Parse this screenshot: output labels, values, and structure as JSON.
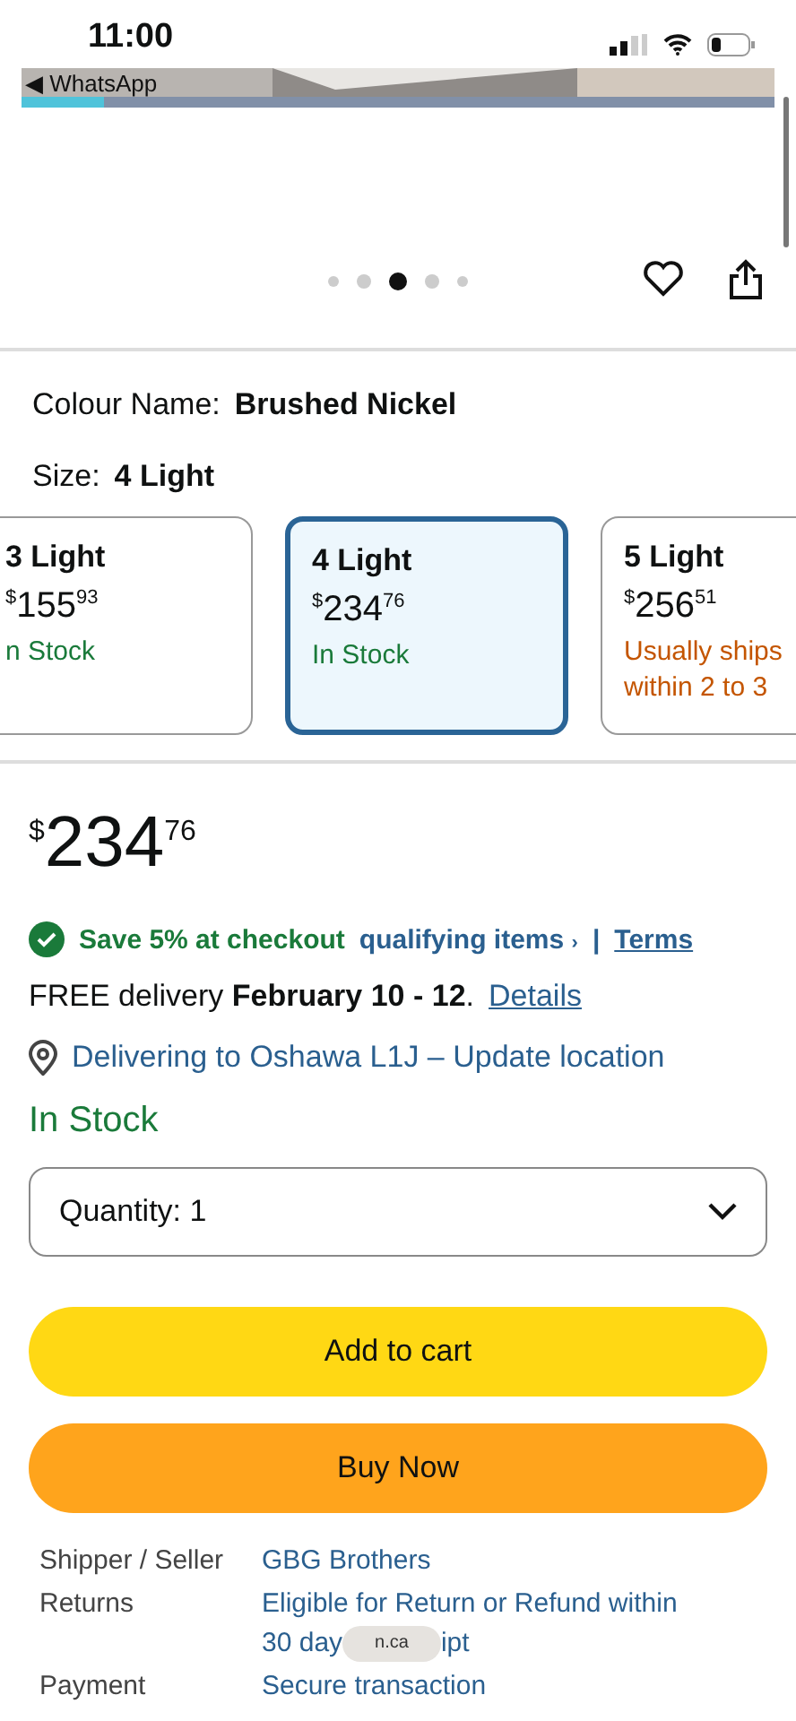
{
  "status_bar": {
    "time": "11:00",
    "back_label": "◀ WhatsApp"
  },
  "gallery": {
    "dots": [
      {
        "selected": false
      },
      {
        "selected": false
      },
      {
        "selected": true
      },
      {
        "selected": false
      },
      {
        "selected": false
      }
    ]
  },
  "colour": {
    "label": "Colour Name:",
    "value": "Brushed Nickel"
  },
  "size": {
    "label": "Size:",
    "value": "4 Light"
  },
  "size_options": [
    {
      "name": "3 Light",
      "currency": "$",
      "whole": "155",
      "fraction": "93",
      "availability": [
        "n Stock"
      ],
      "in_stock": true,
      "selected": false
    },
    {
      "name": "4 Light",
      "currency": "$",
      "whole": "234",
      "fraction": "76",
      "availability": [
        "In Stock"
      ],
      "in_stock": true,
      "selected": true
    },
    {
      "name": "5 Light",
      "currency": "$",
      "whole": "256",
      "fraction": "51",
      "availability": [
        "Usually ships",
        "within 2 to 3"
      ],
      "in_stock": false,
      "selected": false
    }
  ],
  "price": {
    "currency": "$",
    "whole": "234",
    "fraction": "76"
  },
  "promo": {
    "text": "Save 5% at checkout",
    "link": "qualifying items",
    "chevron": "›",
    "separator": "|",
    "terms": "Terms"
  },
  "delivery": {
    "text": "FREE delivery **February 10 - 12**.",
    "link": "Details"
  },
  "location": "Delivering to Oshawa L1J – Update location",
  "stock": "In Stock",
  "quantity": "Quantity: 1",
  "buttons": [
    {
      "label": "Add to cart",
      "kind": "cart"
    },
    {
      "label": "Buy Now",
      "kind": "buy"
    }
  ],
  "details": [
    {
      "label": "Shipper / Seller",
      "value": "GBG Brothers"
    },
    {
      "label": "Returns",
      "value": "Eligible for Return or Refund within",
      "value_2_start": "30 day",
      "value_2_end": "ipt",
      "overlay": "n.ca"
    },
    {
      "label": "Payment",
      "value": "Secure transaction"
    }
  ]
}
